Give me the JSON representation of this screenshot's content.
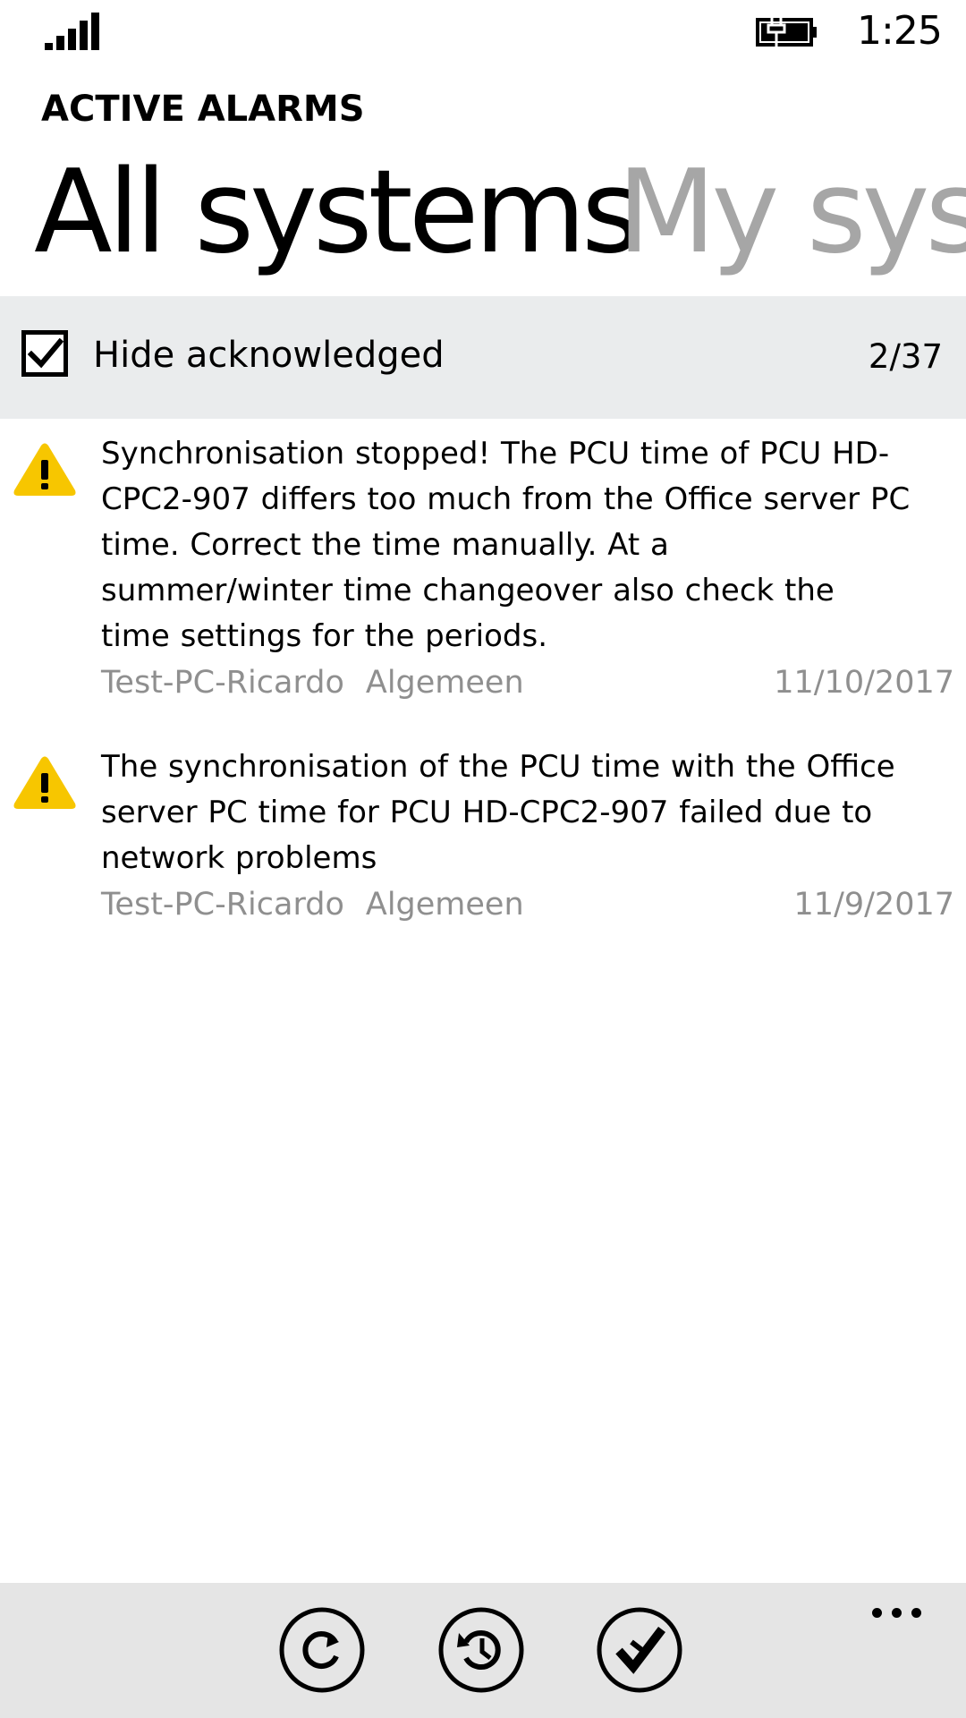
{
  "status_bar": {
    "time": "1:25",
    "signal_icon": "signal-strength-icon",
    "battery_icon": "battery-charging-icon"
  },
  "app": {
    "title": "ACTIVE ALARMS"
  },
  "pivot": {
    "headers": [
      {
        "label": "All systems",
        "active": true
      },
      {
        "label": "My systems",
        "active": false
      }
    ]
  },
  "filter": {
    "checkbox_label": "Hide acknowledged",
    "checked": true,
    "count": "2/37"
  },
  "alarms": [
    {
      "icon": "warning-icon",
      "message": "Synchronisation stopped! The PCU time of PCU HD-CPC2-907 differs too much from the Office server PC time. Correct the time manually. At a summer/winter time changeover also check the time settings for the periods.",
      "system": "Test-PC-Ricardo",
      "group": "Algemeen",
      "date": "11/10/2017"
    },
    {
      "icon": "warning-icon",
      "message": "The synchronisation of the PCU time with the Office server PC time for PCU HD-CPC2-907 failed due to network problems",
      "system": "Test-PC-Ricardo",
      "group": "Algemeen",
      "date": "11/9/2017"
    }
  ],
  "app_bar": {
    "buttons": [
      "refresh-icon",
      "history-icon",
      "acknowledge-check-icon"
    ],
    "more_icon": "more-ellipsis-icon"
  },
  "colors": {
    "warning": "#f7c600",
    "filter_bar_bg": "#eaeced",
    "app_bar_bg": "#e5e5e5",
    "inactive_header": "#a6a6a6",
    "meta_text": "#8f8f8f"
  }
}
